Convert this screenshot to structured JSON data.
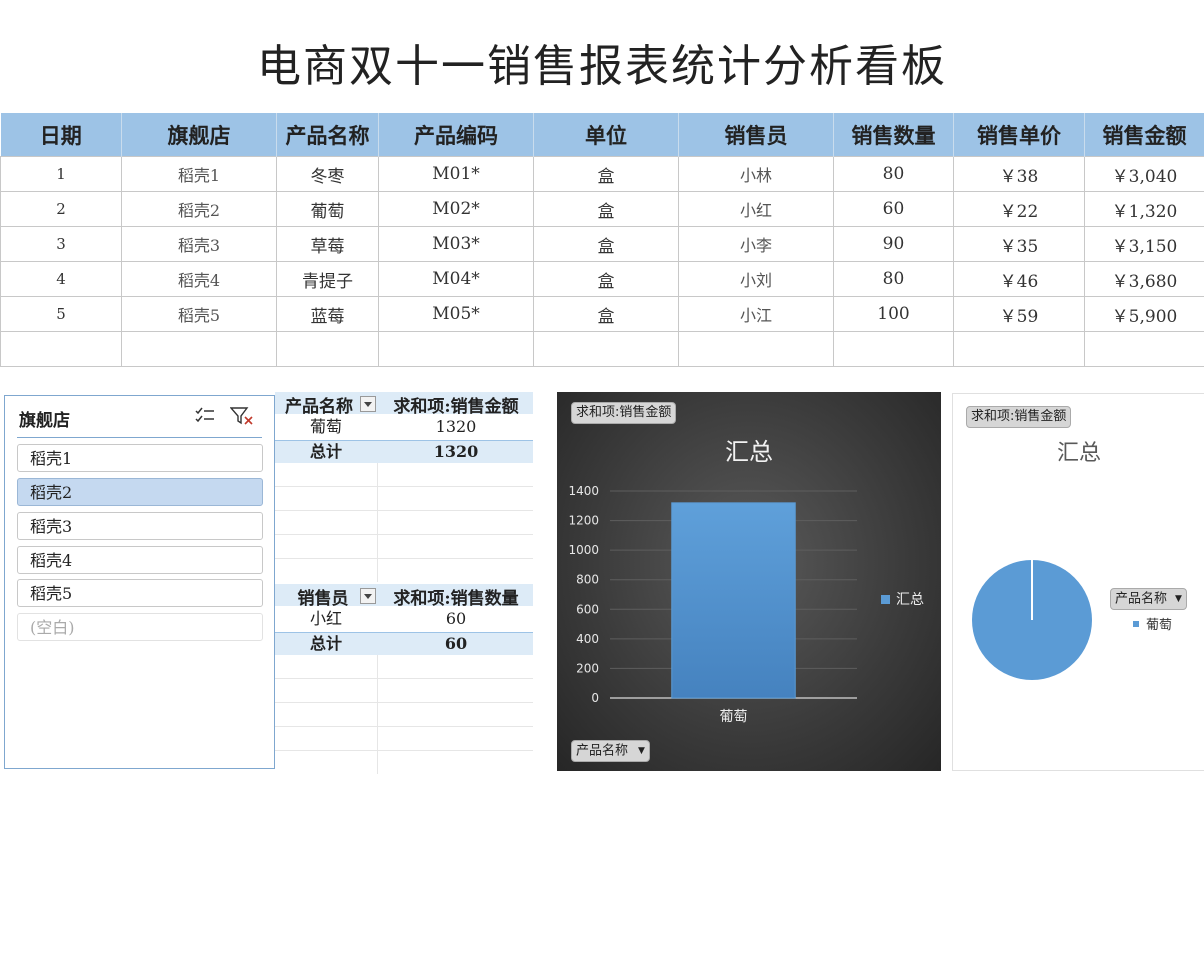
{
  "title": "电商双十一销售报表统计分析看板",
  "table": {
    "headers": [
      "日期",
      "旗舰店",
      "产品名称",
      "产品编码",
      "单位",
      "销售员",
      "销售数量",
      "销售单价",
      "销售金额"
    ],
    "rows": [
      [
        "1",
        "稻壳1",
        "冬枣",
        "M01*",
        "盒",
        "小林",
        "80",
        "￥38",
        "￥3,040"
      ],
      [
        "2",
        "稻壳2",
        "葡萄",
        "M02*",
        "盒",
        "小红",
        "60",
        "￥22",
        "￥1,320"
      ],
      [
        "3",
        "稻壳3",
        "草莓",
        "M03*",
        "盒",
        "小李",
        "90",
        "￥35",
        "￥3,150"
      ],
      [
        "4",
        "稻壳4",
        "青提子",
        "M04*",
        "盒",
        "小刘",
        "80",
        "￥46",
        "￥3,680"
      ],
      [
        "5",
        "稻壳5",
        "蓝莓",
        "M05*",
        "盒",
        "小江",
        "100",
        "￥59",
        "￥5,900"
      ]
    ]
  },
  "slicer": {
    "title": "旗舰店",
    "items": [
      "稻壳1",
      "稻壳2",
      "稻壳3",
      "稻壳4",
      "稻壳5",
      "(空白)"
    ],
    "selected_index": 1
  },
  "pivot1": {
    "col1": "产品名称",
    "col2": "求和项:销售金额",
    "row_label": "葡萄",
    "row_value": "1320",
    "total_label": "总计",
    "total_value": "1320"
  },
  "pivot2": {
    "col1": "销售员",
    "col2": "求和项:销售数量",
    "row_label": "小红",
    "row_value": "60",
    "total_label": "总计",
    "total_value": "60"
  },
  "bar_chart": {
    "field_button": "求和项:销售金额",
    "axis_button": "产品名称",
    "title": "汇总",
    "legend": "汇总",
    "colors": {
      "bar": "#5b9bd5"
    }
  },
  "pie_chart": {
    "field_button": "求和项:销售金额",
    "title": "汇总",
    "legend_button": "产品名称",
    "legend_item": "葡萄",
    "colors": {
      "slice": "#5b9bd5"
    }
  },
  "chart_data": [
    {
      "type": "bar",
      "title": "汇总",
      "categories": [
        "葡萄"
      ],
      "series": [
        {
          "name": "汇总",
          "values": [
            1320
          ]
        }
      ],
      "ylim": [
        0,
        1400
      ],
      "yticks": [
        0,
        200,
        400,
        600,
        800,
        1000,
        1200,
        1400
      ],
      "grid": true,
      "legend": "right"
    },
    {
      "type": "pie",
      "title": "汇总",
      "labels": [
        "葡萄"
      ],
      "values": [
        1320
      ],
      "legend": "right"
    }
  ]
}
